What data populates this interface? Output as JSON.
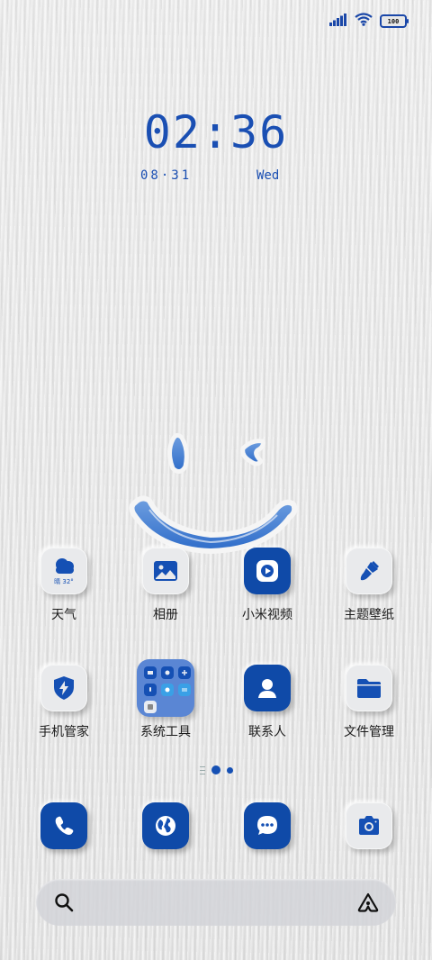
{
  "status_bar": {
    "battery_level": "100",
    "icons": [
      "signal-icon",
      "wifi-icon",
      "battery-icon"
    ]
  },
  "clock": {
    "time": "02:36",
    "date": "08·31",
    "day": "Wed"
  },
  "apps": [
    {
      "label": "天气",
      "icon": "weather-icon",
      "weather_text": "晴 32°"
    },
    {
      "label": "相册",
      "icon": "gallery-icon"
    },
    {
      "label": "小米视频",
      "icon": "video-play-icon"
    },
    {
      "label": "主题壁纸",
      "icon": "paint-brush-icon"
    },
    {
      "label": "手机管家",
      "icon": "shield-bolt-icon"
    },
    {
      "label": "系统工具",
      "icon": "folder-icon"
    },
    {
      "label": "联系人",
      "icon": "contact-icon"
    },
    {
      "label": "文件管理",
      "icon": "file-folder-icon"
    }
  ],
  "dock": [
    {
      "icon": "phone-icon"
    },
    {
      "icon": "browser-globe-icon"
    },
    {
      "icon": "messages-icon"
    },
    {
      "icon": "camera-icon"
    }
  ],
  "pager": {
    "pages": 2,
    "current": 0
  },
  "colors": {
    "accent": "#1550b4",
    "tile": "#e9eaec",
    "folder": "#5a86d4"
  }
}
